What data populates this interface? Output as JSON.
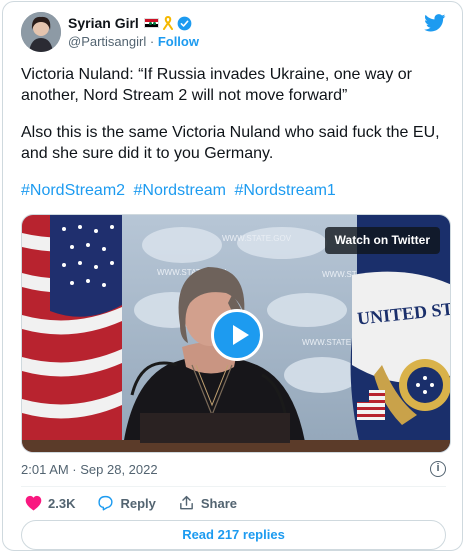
{
  "author": {
    "display_name": "Syrian Girl",
    "handle": "@Partisangirl",
    "follow_label": "Follow",
    "badges": [
      "syria-flag-icon",
      "yellow-ribbon-icon",
      "verified-badge-icon"
    ]
  },
  "tweet": {
    "paragraph1": "Victoria Nuland: “If Russia invades Ukraine, one way or another, Nord Stream 2 will not move forward”",
    "paragraph2": "Also this is the same Victoria Nuland who said fuck the EU, and she sure did it to you Germany.",
    "hashtags": [
      "#NordStream2",
      "#Nordstream",
      "#Nordstream1"
    ]
  },
  "media": {
    "watch_label": "Watch on Twitter",
    "seal_text": "UNITED STA",
    "backdrop_text": "WWW.STATE.GOV"
  },
  "meta": {
    "timestamp": "2:01 AM · Sep 28, 2022"
  },
  "actions": {
    "likes": "2.3K",
    "reply_label": "Reply",
    "share_label": "Share"
  },
  "read_replies_label": "Read 217 replies",
  "colors": {
    "accent": "#1d9bf0",
    "like": "#f91880",
    "text": "#0f1419",
    "muted": "#536471"
  }
}
